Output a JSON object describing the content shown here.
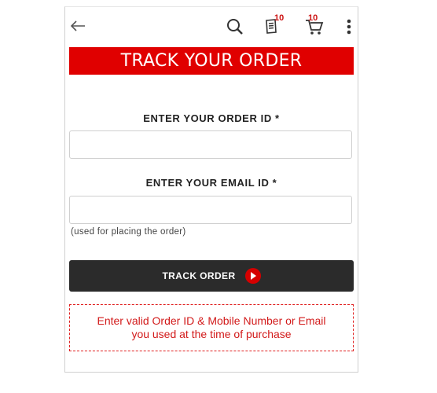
{
  "header": {
    "orders_count": "10",
    "cart_count": "10",
    "icons": [
      "back-arrow-icon",
      "search-icon",
      "orders-receipt-icon",
      "cart-icon",
      "more-vertical-icon"
    ]
  },
  "page": {
    "title": "TRACK YOUR ORDER"
  },
  "form": {
    "order_id_label": "ENTER YOUR ORDER ID *",
    "order_id_value": "",
    "email_label": "ENTER YOUR EMAIL ID *",
    "email_value": "",
    "email_hint": "(used for placing the order)",
    "submit_label": "TRACK ORDER"
  },
  "message": {
    "line1": "Enter valid Order ID & Mobile Number or Email",
    "line2": "you used at the time of purchase"
  },
  "colors": {
    "accent_red": "#e00000",
    "button_dark": "#2b2b2b",
    "error_red": "#d21a1a"
  }
}
